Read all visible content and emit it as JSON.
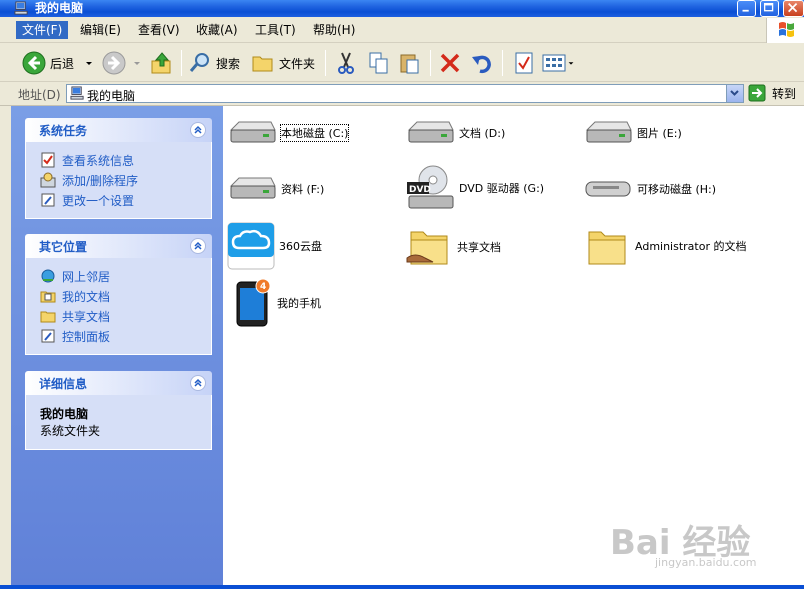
{
  "window": {
    "title": "我的电脑"
  },
  "menu": [
    {
      "label": "文件(F)"
    },
    {
      "label": "编辑(E)"
    },
    {
      "label": "查看(V)"
    },
    {
      "label": "收藏(A)"
    },
    {
      "label": "工具(T)"
    },
    {
      "label": "帮助(H)"
    }
  ],
  "toolbar": {
    "back_label": "后退",
    "search_label": "搜索",
    "folders_label": "文件夹"
  },
  "address": {
    "label": "地址(D)",
    "value": "我的电脑",
    "go_label": "转到"
  },
  "tasks": {
    "system": {
      "title": "系统任务",
      "items": [
        "查看系统信息",
        "添加/删除程序",
        "更改一个设置"
      ]
    },
    "other": {
      "title": "其它位置",
      "items": [
        "网上邻居",
        "我的文档",
        "共享文档",
        "控制面板"
      ]
    },
    "details": {
      "title": "详细信息",
      "name": "我的电脑",
      "desc": "系统文件夹"
    }
  },
  "items": [
    {
      "label": "本地磁盘 (C:)",
      "icon": "hard-drive-icon"
    },
    {
      "label": "文档 (D:)",
      "icon": "hard-drive-icon"
    },
    {
      "label": "图片 (E:)",
      "icon": "hard-drive-icon"
    },
    {
      "label": "资料 (F:)",
      "icon": "hard-drive-icon"
    },
    {
      "label": "DVD 驱动器 (G:)",
      "icon": "dvd-drive-icon"
    },
    {
      "label": "可移动磁盘 (H:)",
      "icon": "removable-disk-icon"
    },
    {
      "label": "360云盘",
      "icon": "cloud-drive-icon"
    },
    {
      "label": "共享文档",
      "icon": "shared-folder-icon"
    },
    {
      "label": "Administrator 的文档",
      "icon": "folder-icon"
    },
    {
      "label": "我的手机",
      "icon": "phone-icon"
    }
  ],
  "watermark": {
    "brand": "Bai 经验",
    "url": "jingyan.baidu.com"
  },
  "colors": {
    "accent": "#316AC5",
    "task_link": "#215dc6",
    "pane": "#6f8fe0"
  }
}
